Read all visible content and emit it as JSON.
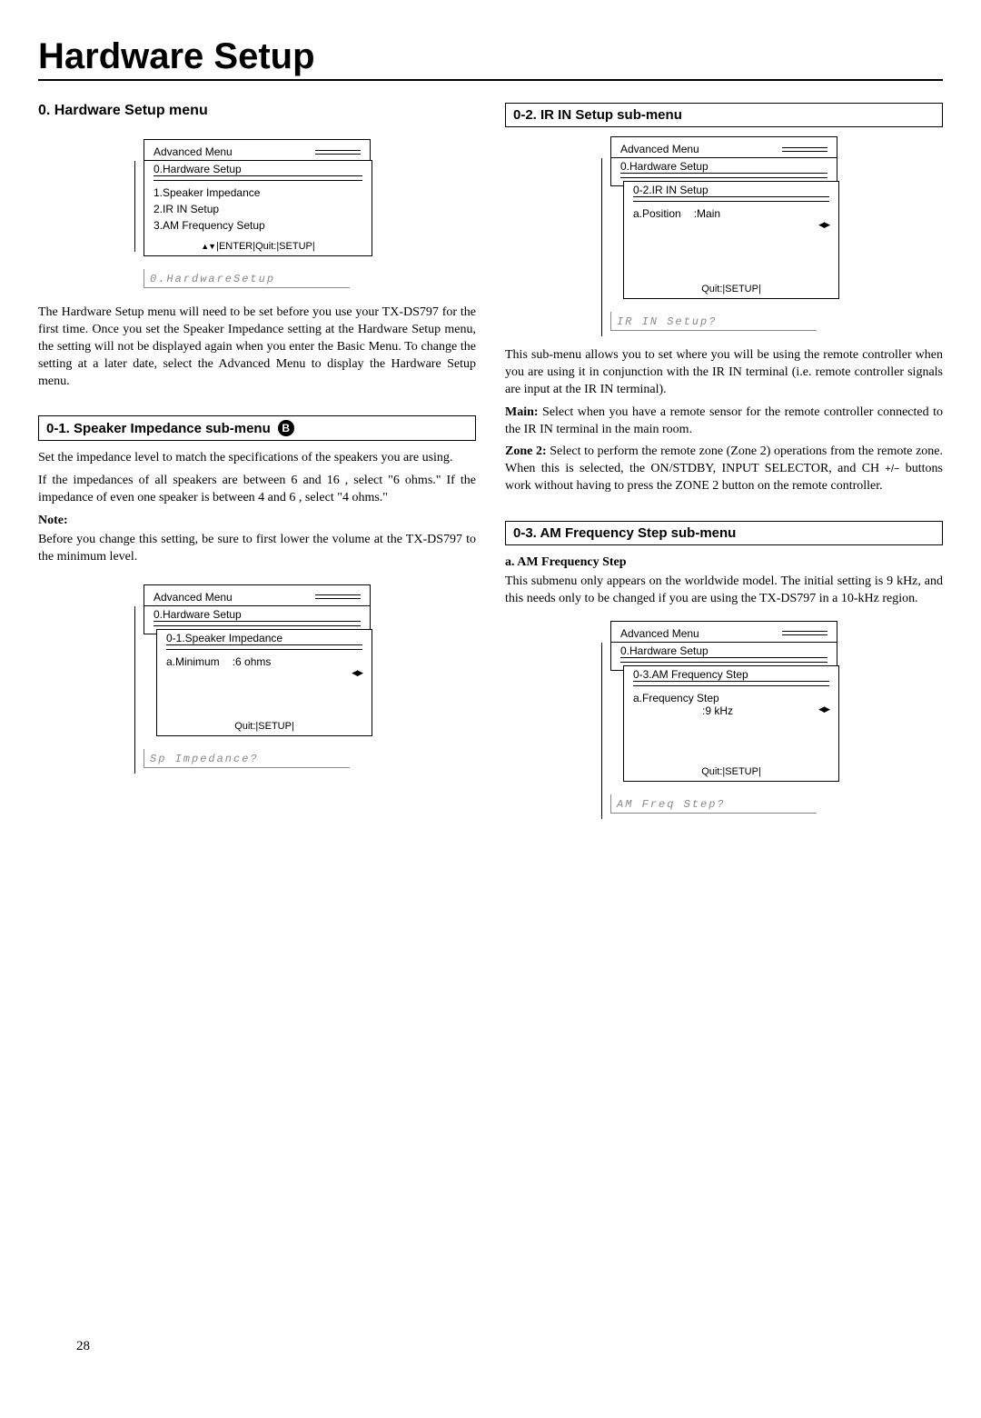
{
  "page_title": "Hardware Setup",
  "page_number": "28",
  "left": {
    "section0": {
      "heading": "0. Hardware Setup menu",
      "osd": {
        "advanced": "Advanced Menu",
        "title": "0.Hardware Setup",
        "items": [
          "1.Speaker Impedance",
          "2.IR IN Setup",
          "3.AM Frequency Setup"
        ],
        "footer": "|ENTER|Quit:|SETUP|"
      },
      "lcd": "0.HardwareSetup",
      "para": "The Hardware Setup menu will need to be set before you use your TX-DS797 for the first time. Once you set the Speaker Impedance setting at the Hardware Setup menu, the setting will not be displayed again when you enter the Basic Menu. To change the setting at a later date, select the Advanced Menu to display the Hardware Setup menu."
    },
    "section01": {
      "heading": "0-1.  Speaker Impedance sub-menu",
      "badge": "B",
      "para1": "Set the impedance level to match the specifications of the speakers you are using.",
      "para2a": "If the impedances of all speakers are between 6 and 16   , select \"6 ohms.\" If the impedance of even one speaker is between 4 and 6   , select \"4 ohms.\"",
      "note_label": "Note:",
      "note_body": "Before you change this setting, be sure to first lower the volume at the TX-DS797 to the minimum level.",
      "osd": {
        "advanced": "Advanced Menu",
        "title": "0.Hardware Setup",
        "subtitle": "0-1.Speaker Impedance",
        "param_label": "a.Minimum",
        "param_value": ":6 ohms",
        "footer": "Quit:|SETUP|"
      },
      "lcd": "Sp Impedance?"
    }
  },
  "right": {
    "section02": {
      "heading": "0-2. IR IN Setup sub-menu",
      "osd": {
        "advanced": "Advanced Menu",
        "title": "0.Hardware Setup",
        "subtitle": "0-2.IR IN Setup",
        "param_label": "a.Position",
        "param_value": ":Main",
        "footer": "Quit:|SETUP|"
      },
      "lcd": "IR IN Setup?",
      "para1": "This sub-menu allows you to set where you will be using the remote controller when you are using it in conjunction with the IR IN terminal (i.e. remote controller signals are input at the IR IN terminal).",
      "main_label": "Main:",
      "main_body": " Select when you have a remote sensor for the remote controller connected to the IR IN terminal in the main room.",
      "zone2_label": "Zone 2:",
      "zone2_body_a": " Select to perform the remote zone (Zone 2) operations from the remote zone. When this is selected, the ON/STDBY, INPUT SELECTOR, and CH ",
      "zone2_body_b": " buttons work without having to press the ZONE 2 button on the remote controller."
    },
    "section03": {
      "heading": "0-3.  AM Frequency Step sub-menu",
      "item_label": "a.   AM Frequency Step",
      "para": "This submenu only appears on the worldwide model. The initial setting is 9 kHz, and this needs only to be changed if you are using the TX-DS797 in a 10-kHz region.",
      "osd": {
        "advanced": "Advanced Menu",
        "title": "0.Hardware Setup",
        "subtitle": "0-3.AM Frequency Step",
        "param_label": "a.Frequency Step",
        "param_value": ":9 kHz",
        "footer": "Quit:|SETUP|"
      },
      "lcd": "AM Freq Step?"
    }
  }
}
